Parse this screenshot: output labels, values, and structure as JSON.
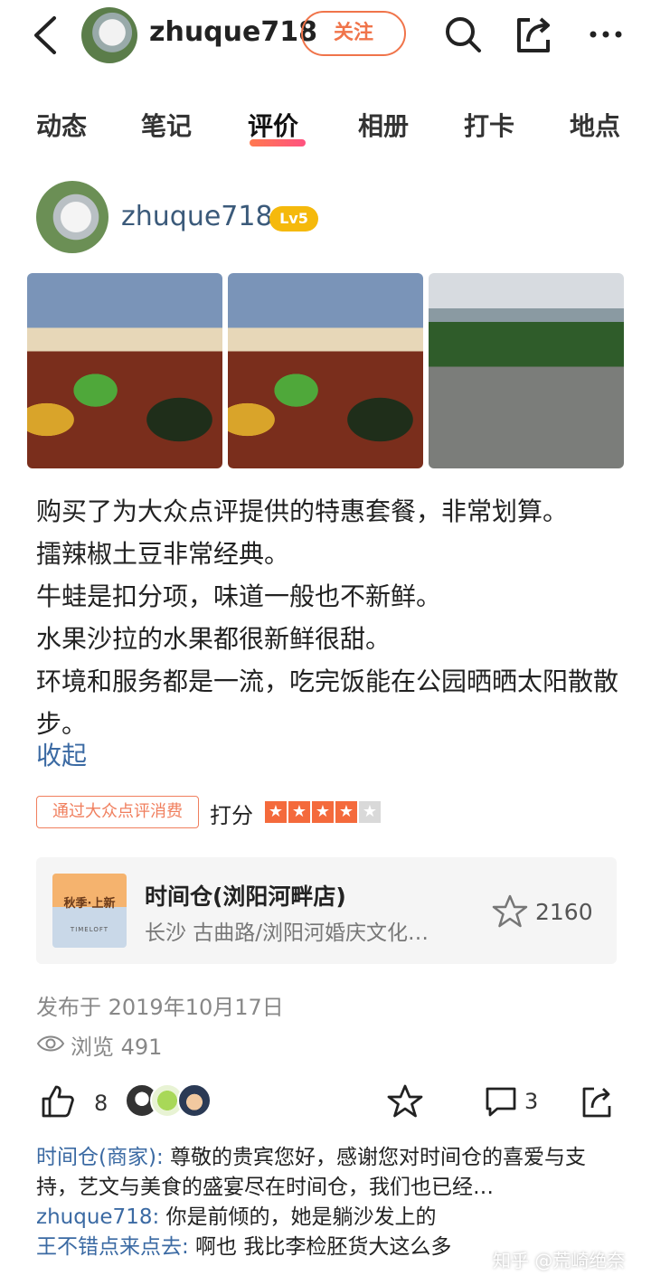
{
  "header": {
    "username": "zhuque718",
    "follow_label": "关注"
  },
  "tabs": [
    {
      "label": "动态"
    },
    {
      "label": "笔记"
    },
    {
      "label": "评价"
    },
    {
      "label": "相册"
    },
    {
      "label": "打卡"
    },
    {
      "label": "地点"
    }
  ],
  "active_tab": "评价",
  "author": {
    "name": "zhuque718",
    "level": "Lv5"
  },
  "review": {
    "lines": [
      "购买了为大众点评提供的特惠套餐，非常划算。",
      "擂辣椒土豆非常经典。",
      "牛蛙是扣分项，味道一般也不新鲜。",
      "水果沙拉的水果都很新鲜很甜。",
      "环境和服务都是一流，吃完饭能在公园晒晒太阳散散步。"
    ],
    "collapse_label": "收起",
    "badge": "通过大众点评消费",
    "score_label": "打分",
    "rating": 4,
    "rating_max": 5
  },
  "shop": {
    "thumb_text_1": "秋季·上新",
    "thumb_text_2": "TIMELOFT",
    "name": "时间仓(浏阳河畔店)",
    "location": "长沙 古曲路/浏阳河婚庆文化…",
    "favorites": "2160"
  },
  "meta": {
    "published": "发布于 2019年10月17日",
    "views": "浏览 491"
  },
  "actions": {
    "likes": "8",
    "comments": "3"
  },
  "comments": [
    {
      "author": "时间仓(商家):",
      "text": " 尊敬的贵宾您好，感谢您对时间仓的喜爱与支持，艺文与美食的盛宴尽在时间仓，我们也已经…"
    },
    {
      "author": "zhuque718:",
      "text": " 你是前倾的，她是躺沙发上的"
    },
    {
      "author": "王不错点来点去:",
      "text": " 啊也 我比李检胚货大这么多"
    }
  ],
  "watermark": "知乎 @荒崎绝奈",
  "colors": {
    "accent": "#f0744a",
    "link": "#3b6aa3",
    "level_badge": "#f5b90c"
  }
}
